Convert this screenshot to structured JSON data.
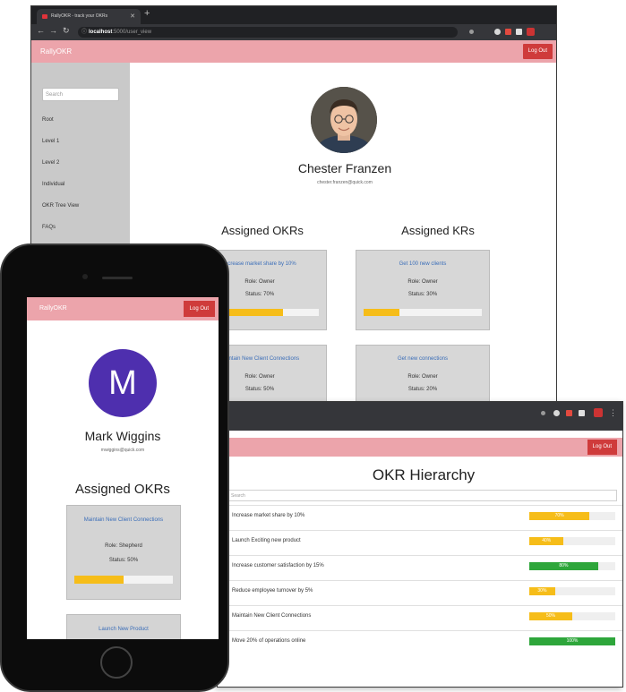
{
  "colors": {
    "brand_pink": "#eca4ab",
    "logout_red": "#cf3b3b",
    "progress_yellow": "#f6bd19",
    "progress_green": "#2ea63b",
    "link_blue": "#3a6db8",
    "avatar_purple": "#4e2fae"
  },
  "desktop": {
    "tab_title": "RallyOKR - track your OKRs",
    "url_host": "localhost",
    "url_path": ":5000/user_view",
    "brand": "RallyOKR",
    "logout": "Log Out",
    "search_placeholder": "Search",
    "nav": [
      "Root",
      "Level 1",
      "Level 2",
      "Individual",
      "OKR Tree View",
      "FAQs"
    ],
    "user_name": "Chester Franzen",
    "user_email": "chester.franzen@quick.com",
    "okrs_heading": "Assigned OKRs",
    "krs_heading": "Assigned KRs",
    "okr_cards": [
      {
        "title": "Increase market share by 10%",
        "role": "Role: Owner",
        "status": "Status: 70%",
        "progress": 0.7
      },
      {
        "title": "Maintain New Client Connections",
        "role": "Role: Owner",
        "status": "Status: 50%",
        "progress": 0.5
      }
    ],
    "kr_cards": [
      {
        "title": "Get 100 new clients",
        "role": "Role: Owner",
        "status": "Status: 30%",
        "progress": 0.3
      },
      {
        "title": "Get new connections",
        "role": "Role: Owner",
        "status": "Status: 20%",
        "progress": 0.2
      }
    ]
  },
  "hierarchy": {
    "logout": "Log Out",
    "title": "OKR Hierarchy",
    "search_placeholder": "Search",
    "rows": [
      {
        "label": "Increase market share by 10%",
        "pct": "70%",
        "progress": 0.7,
        "color": "#f6bd19"
      },
      {
        "label": "Launch Exciting new product",
        "pct": "40%",
        "progress": 0.4,
        "color": "#f6bd19"
      },
      {
        "label": "Increase customer satisfaction by 15%",
        "pct": "80%",
        "progress": 0.8,
        "color": "#2ea63b"
      },
      {
        "label": "Reduce employee turnover by 5%",
        "pct": "30%",
        "progress": 0.3,
        "color": "#f6bd19"
      },
      {
        "label": "Maintain New Client Connections",
        "pct": "50%",
        "progress": 0.5,
        "color": "#f6bd19"
      },
      {
        "label": "Move 20% of operations online",
        "pct": "100%",
        "progress": 1.0,
        "color": "#2ea63b"
      }
    ]
  },
  "phone": {
    "brand": "RallyOKR",
    "logout": "Log Out",
    "avatar_letter": "M",
    "user_name": "Mark Wiggins",
    "user_email": "mwiggins@quick.com",
    "okrs_heading": "Assigned OKRs",
    "cards": [
      {
        "title": "Maintain New Client Connections",
        "role": "Role: Shepherd",
        "status": "Status: 50%",
        "progress": 0.5
      },
      {
        "title": "Launch New Product",
        "role": "",
        "status": "",
        "progress": 0
      }
    ]
  }
}
